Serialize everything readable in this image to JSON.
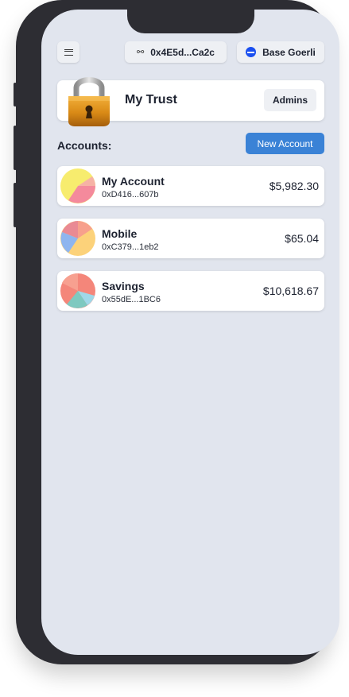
{
  "header": {
    "menu_icon": "hamburger-menu-icon",
    "link_icon": "link-icon",
    "address": "0x4E5d...Ca2c",
    "network": "Base Goerli",
    "network_color": "#1a4ff0"
  },
  "trust": {
    "icon": "padlock-icon",
    "title": "My Trust",
    "admins_label": "Admins"
  },
  "accounts_section": {
    "label": "Accounts:",
    "new_account_label": "New Account",
    "new_account_color": "#3a82d6"
  },
  "accounts": [
    {
      "name": "My Account",
      "address": "0xD416...607b",
      "balance": "$5,982.30"
    },
    {
      "name": "Mobile",
      "address": "0xC379...1eb2",
      "balance": "$65.04"
    },
    {
      "name": "Savings",
      "address": "0x55dE...1BC6",
      "balance": "$10,618.67"
    }
  ]
}
